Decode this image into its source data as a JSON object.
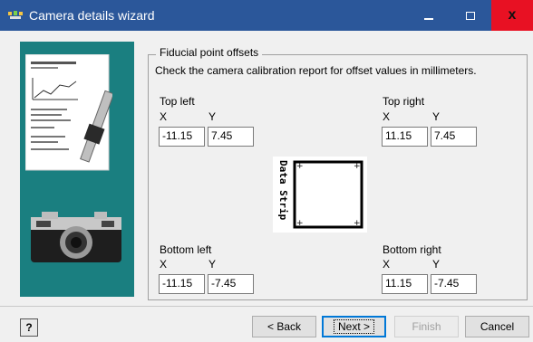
{
  "window": {
    "title": "Camera details wizard",
    "icon": "wizard-icon",
    "minimize_icon": "minimize-icon",
    "maximize_icon": "maximize-icon",
    "close_label": "x"
  },
  "group": {
    "title": "Fiducial point offsets",
    "instructions": "Check the camera calibration report for offset values in millimeters."
  },
  "fiducials": {
    "top_left": {
      "label": "Top left",
      "x_label": "X",
      "y_label": "Y",
      "x": "-11.15",
      "y": "7.45"
    },
    "top_right": {
      "label": "Top right",
      "x_label": "X",
      "y_label": "Y",
      "x": "11.15",
      "y": "7.45"
    },
    "bottom_left": {
      "label": "Bottom left",
      "x_label": "X",
      "y_label": "Y",
      "x": "-11.15",
      "y": "-7.45"
    },
    "bottom_right": {
      "label": "Bottom right",
      "x_label": "X",
      "y_label": "Y",
      "x": "11.15",
      "y": "-7.45"
    }
  },
  "diagram": {
    "strip_text": "Data Strip"
  },
  "footer": {
    "help_label": "?",
    "back_label": "< Back",
    "next_label": "Next >",
    "finish_label": "Finish",
    "cancel_label": "Cancel"
  },
  "colors": {
    "titlebar": "#2b579a",
    "close": "#e81123",
    "panel": "#1a7f80"
  }
}
